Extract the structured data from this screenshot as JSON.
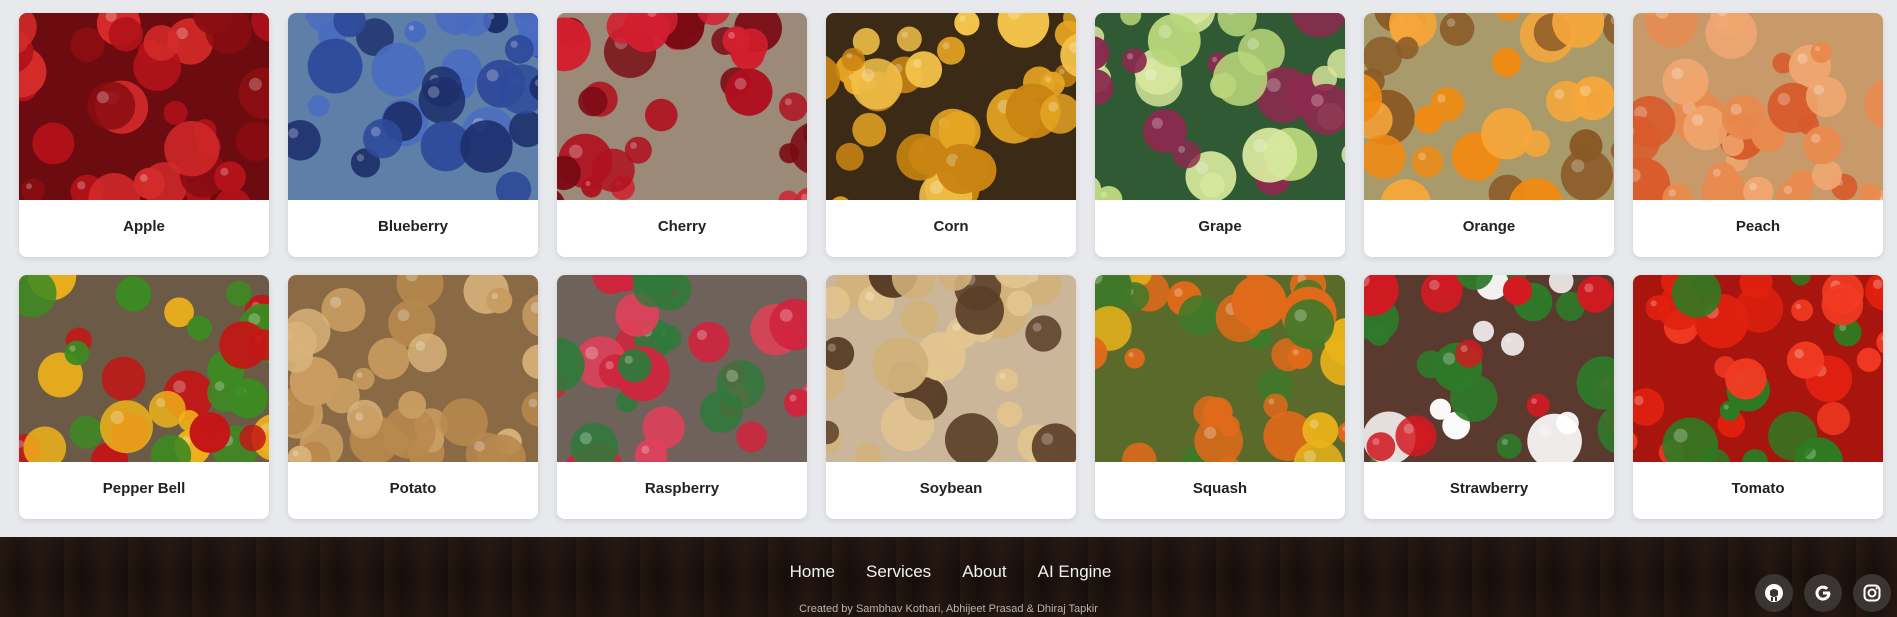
{
  "crops": [
    {
      "name": "Apple",
      "palette": [
        "#b3121a",
        "#d42a2a",
        "#8a0d12"
      ],
      "bg": "#6d0c10"
    },
    {
      "name": "Blueberry",
      "palette": [
        "#2e4a9a",
        "#4a6cc0",
        "#1d2f6b"
      ],
      "bg": "#5d7fa8"
    },
    {
      "name": "Cherry",
      "palette": [
        "#b0101f",
        "#d21f2f",
        "#7a0a14"
      ],
      "bg": "#9b8a78"
    },
    {
      "name": "Corn",
      "palette": [
        "#e6a623",
        "#f3c24a",
        "#c98412"
      ],
      "bg": "#3a2a16"
    },
    {
      "name": "Grape",
      "palette": [
        "#b8d67a",
        "#8a2b4e",
        "#d7e89d"
      ],
      "bg": "#2f5a34"
    },
    {
      "name": "Orange",
      "palette": [
        "#f08a12",
        "#f6a63a",
        "#8a5a26"
      ],
      "bg": "#a89a6a"
    },
    {
      "name": "Peach",
      "palette": [
        "#f0a770",
        "#e88a4e",
        "#d85a2a"
      ],
      "bg": "#c89a6a"
    },
    {
      "name": "Pepper Bell",
      "palette": [
        "#c41616",
        "#f2b41a",
        "#3d8a22"
      ],
      "bg": "#6a5a46"
    },
    {
      "name": "Potato",
      "palette": [
        "#d8b27a",
        "#c99d62",
        "#b8894e"
      ],
      "bg": "#8a6a44"
    },
    {
      "name": "Raspberry",
      "palette": [
        "#d0243e",
        "#e0405a",
        "#2f7a3a"
      ],
      "bg": "#6e625a"
    },
    {
      "name": "Soybean",
      "palette": [
        "#e2c58e",
        "#d2b27a",
        "#5a3e28"
      ],
      "bg": "#cbb69a"
    },
    {
      "name": "Squash",
      "palette": [
        "#e8b21a",
        "#3e7a2a",
        "#e06a1a"
      ],
      "bg": "#5a6a2a"
    },
    {
      "name": "Strawberry",
      "palette": [
        "#d21a22",
        "#ffffff",
        "#2e7a2a"
      ],
      "bg": "#5a3a2e"
    },
    {
      "name": "Tomato",
      "palette": [
        "#e0200f",
        "#f23a22",
        "#2e7a22"
      ],
      "bg": "#a8140e"
    }
  ],
  "footer": {
    "nav": [
      "Home",
      "Services",
      "About",
      "AI Engine"
    ],
    "credit": "Created by Sambhav Kothari, Abhijeet Prasad & Dhiraj Tapkir",
    "socials": [
      {
        "icon": "github-icon",
        "glyph": "●"
      },
      {
        "icon": "google-icon",
        "glyph": "G"
      },
      {
        "icon": "instagram-icon",
        "glyph": "▢"
      }
    ]
  }
}
